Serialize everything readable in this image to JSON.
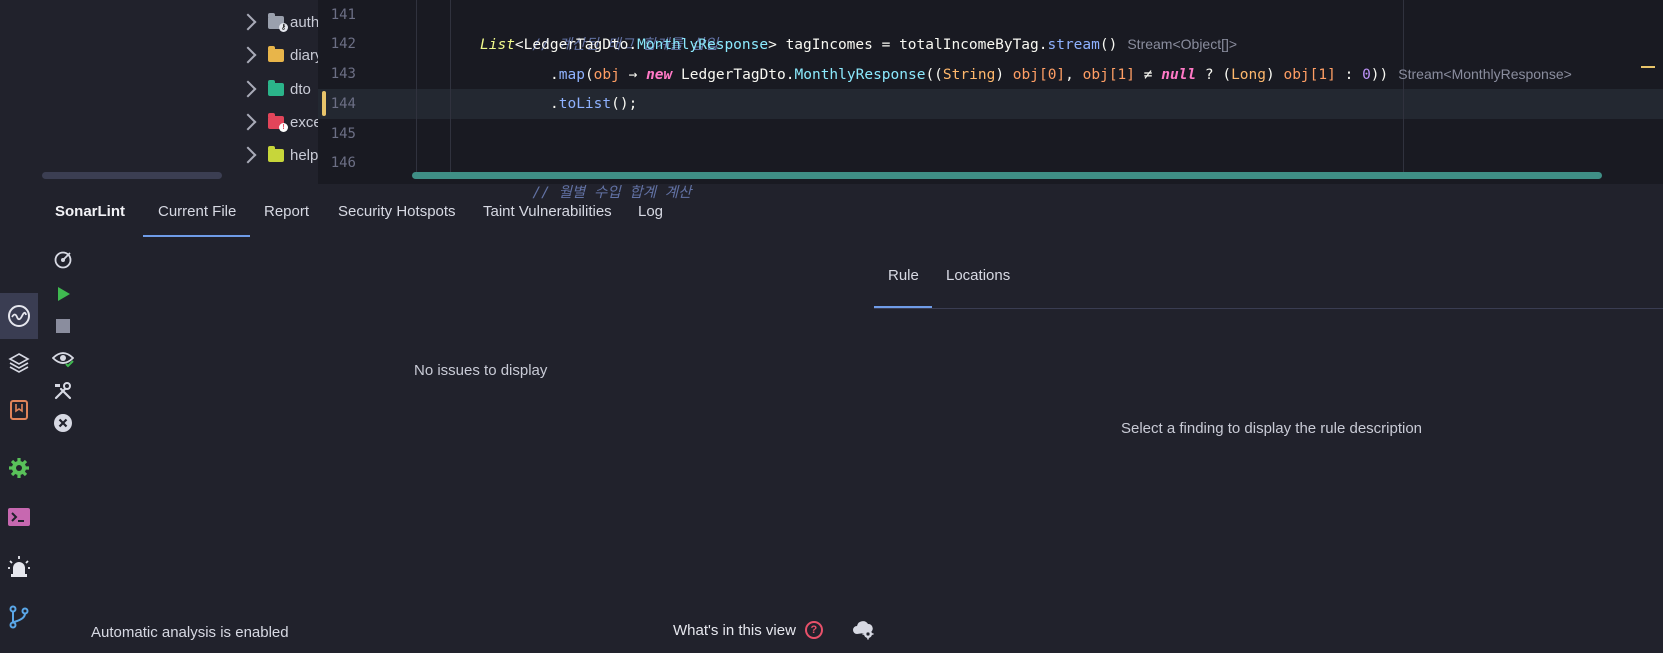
{
  "project_tree": {
    "items": [
      {
        "label": "auth",
        "color": "#9aa0ad",
        "badge": "key"
      },
      {
        "label": "diary",
        "color": "#e8b54a",
        "badge": ""
      },
      {
        "label": "dto",
        "color": "#2bb48a",
        "badge": ""
      },
      {
        "label": "exce",
        "color": "#e2455a",
        "badge": "!"
      },
      {
        "label": "help",
        "color": "#c7d63a",
        "badge": ""
      }
    ]
  },
  "editor": {
    "lines": [
      {
        "num": "141"
      },
      {
        "num": "142"
      },
      {
        "num": "143"
      },
      {
        "num": "144"
      },
      {
        "num": "145"
      },
      {
        "num": "146"
      }
    ],
    "code": {
      "l141_comment": "// 계산된 태그 합계를 삽입",
      "l142_list": "List",
      "l142_generic": "<LedgerTagDto.",
      "l142_resp": "MonthlyResponse",
      "l142_close": "> ",
      "l142_var": "tagIncomes",
      "l142_eq": " = ",
      "l142_obj": "totalIncomeByTag.",
      "l142_stream": "stream",
      "l142_paren": "()",
      "l142_hint": "Stream<Object[]>",
      "l143_dot": ".",
      "l143_map": "map",
      "l143_open": "(",
      "l143_obj": "obj",
      "l143_arrow": " → ",
      "l143_new": "new",
      "l143_cls": " LedgerTagDto.",
      "l143_resp": "MonthlyResponse",
      "l143_rest1": "((",
      "l143_string": "String",
      "l143_rest2": ") ",
      "l143_obj0": "obj[0]",
      "l143_comma": ", ",
      "l143_obj1": "obj[1]",
      "l143_ne": " ≠ ",
      "l143_null": "null",
      "l143_q": " ? (",
      "l143_long": "Long",
      "l143_rest3": ") ",
      "l143_obj1b": "obj[1]",
      "l143_colon": " : ",
      "l143_zero": "0",
      "l143_end": "))",
      "l143_hint": "Stream<MonthlyResponse>",
      "l144_dot": ".",
      "l144_tolist": "toList",
      "l144_end": "();",
      "l146_comment": "// 월별 수입 합계 계산"
    }
  },
  "toolwindow": {
    "title": "SonarLint",
    "tabs": [
      "Current File",
      "Report",
      "Security Hotspots",
      "Taint Vulnerabilities",
      "Log"
    ],
    "active_tab": "Current File",
    "empty_message": "No issues to display",
    "status": "Automatic analysis is enabled",
    "right_tabs": [
      "Rule",
      "Locations"
    ],
    "rule_message": "Select a finding to display the rule description",
    "whats_in_view": "What's in this view",
    "help_glyph": "?"
  },
  "icons": {
    "left_toolbar": [
      "sonarlint-icon",
      "layers-icon",
      "bookmarks-icon",
      "settings-icon",
      "terminal-icon",
      "alarm-icon",
      "git-branch-icon"
    ],
    "actions": [
      "analyze-file-icon",
      "run-icon",
      "stop-icon",
      "show-resolved-icon",
      "configure-icon",
      "clear-icon"
    ]
  },
  "colors": {
    "accent": "#6f9ce8",
    "run_green": "#3fb950",
    "settings_green": "#59c15a",
    "help_red": "#e8516a",
    "bookmark_orange": "#e0845a",
    "terminal_pink": "#c768b0",
    "branch_blue": "#5aa7e8"
  }
}
